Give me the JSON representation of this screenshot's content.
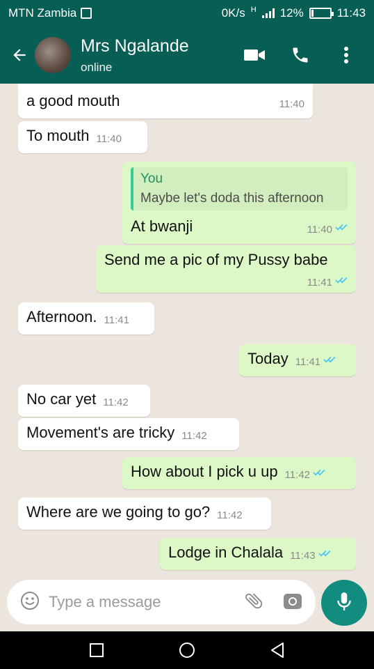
{
  "status_bar": {
    "carrier": "MTN Zambia",
    "speed": "0K/s",
    "network": "H",
    "battery": "12%",
    "battery_level": 0.12,
    "time": "11:43"
  },
  "header": {
    "name": "Mrs Ngalande",
    "status": "online",
    "icons": [
      "back-arrow-icon",
      "video-call-icon",
      "phone-icon",
      "more-vert-icon"
    ]
  },
  "messages": [
    {
      "side": "in",
      "text": "a good mouth",
      "time": "11:40"
    },
    {
      "side": "in",
      "text": "To mouth",
      "time": "11:40"
    },
    {
      "side": "out",
      "quote_author": "You",
      "quote_text": "Maybe let's  doda this afternoon",
      "text": "At bwanji",
      "time": "11:40",
      "read": true
    },
    {
      "side": "out",
      "text": "Send me a pic of my Pussy babe",
      "time": "11:41",
      "read": true
    },
    {
      "side": "in",
      "text": "Afternoon.",
      "time": "11:41"
    },
    {
      "side": "out",
      "text": "Today",
      "time": "11:41",
      "read": true
    },
    {
      "side": "in",
      "text": "No car yet",
      "time": "11:42"
    },
    {
      "side": "in",
      "text": "Movement's are tricky",
      "time": "11:42"
    },
    {
      "side": "out",
      "text": "How about I pick u up",
      "time": "11:42",
      "read": true
    },
    {
      "side": "in",
      "text": "Where are we going to go?",
      "time": "11:42"
    },
    {
      "side": "out",
      "text": "Lodge in Chalala",
      "time": "11:43",
      "read": true
    }
  ],
  "composer": {
    "placeholder": "Type a message",
    "icons": [
      "emoji-icon",
      "attach-icon",
      "camera-icon",
      "mic-icon"
    ]
  },
  "colors": {
    "primary": "#075e54",
    "accent": "#128c7e",
    "outgoing_bubble": "#dcf8c6",
    "incoming_bubble": "#ffffff",
    "read_ticks": "#4fc3f7"
  }
}
